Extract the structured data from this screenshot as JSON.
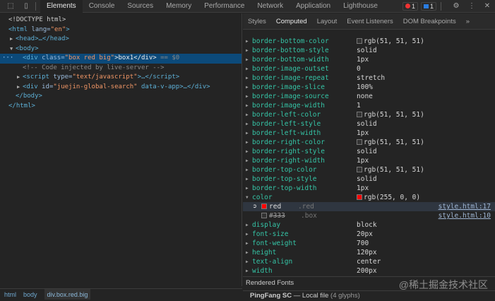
{
  "toolbar": {
    "tabs": [
      "Elements",
      "Console",
      "Sources",
      "Memory",
      "Performance",
      "Network",
      "Application",
      "Lighthouse"
    ],
    "errors": "1",
    "messages": "1"
  },
  "dom": {
    "doctype": "<!DOCTYPE html>",
    "html_open": "<html",
    "lang_attr": " lang=",
    "lang_val": "\"en\"",
    "head": "<head>…</head>",
    "body_open": "<body>",
    "div_open": "<div",
    "div_attr": " class=",
    "div_val": "\"box red big\"",
    "div_text": ">box1</div>",
    "div_marker": " == $0",
    "comment": "<!-- Code injected by live-server -->",
    "script_open": "<script",
    "script_attr": " type=",
    "script_val": "\"text/javascript\"",
    "script_close": ">…</script>",
    "div2_open": "<div",
    "div2_attr": " id=",
    "div2_val": "\"juejin-global-search\"",
    "div2_rest": " data-v-app>…</div>",
    "body_close": "</body>",
    "html_close": "</html>"
  },
  "breadcrumbs": [
    "html",
    "body",
    "div.box.red.big"
  ],
  "subtabs": [
    "Styles",
    "Computed",
    "Layout",
    "Event Listeners",
    "DOM Breakpoints",
    "»"
  ],
  "props": [
    {
      "name": "border-bottom-color",
      "value": "rgb(51, 51, 51)",
      "swatch": "#333333"
    },
    {
      "name": "border-bottom-style",
      "value": "solid"
    },
    {
      "name": "border-bottom-width",
      "value": "1px"
    },
    {
      "name": "border-image-outset",
      "value": "0"
    },
    {
      "name": "border-image-repeat",
      "value": "stretch"
    },
    {
      "name": "border-image-slice",
      "value": "100%"
    },
    {
      "name": "border-image-source",
      "value": "none"
    },
    {
      "name": "border-image-width",
      "value": "1"
    },
    {
      "name": "border-left-color",
      "value": "rgb(51, 51, 51)",
      "swatch": "#333333"
    },
    {
      "name": "border-left-style",
      "value": "solid"
    },
    {
      "name": "border-left-width",
      "value": "1px"
    },
    {
      "name": "border-right-color",
      "value": "rgb(51, 51, 51)",
      "swatch": "#333333"
    },
    {
      "name": "border-right-style",
      "value": "solid"
    },
    {
      "name": "border-right-width",
      "value": "1px"
    },
    {
      "name": "border-top-color",
      "value": "rgb(51, 51, 51)",
      "swatch": "#333333"
    },
    {
      "name": "border-top-style",
      "value": "solid"
    },
    {
      "name": "border-top-width",
      "value": "1px"
    },
    {
      "name": "color",
      "value": "rgb(255, 0, 0)",
      "swatch": "#ff0000"
    }
  ],
  "color_traces": [
    {
      "value": "red",
      "selector": ".red",
      "source": "style.html:17",
      "swatch": "#ff0000"
    },
    {
      "value": "#333",
      "selector": ".box",
      "source": "style.html:10",
      "swatch": "#333333"
    }
  ],
  "props2": [
    {
      "name": "display",
      "value": "block"
    },
    {
      "name": "font-size",
      "value": "20px"
    },
    {
      "name": "font-weight",
      "value": "700"
    },
    {
      "name": "height",
      "value": "120px"
    },
    {
      "name": "text-align",
      "value": "center"
    },
    {
      "name": "width",
      "value": "200px"
    }
  ],
  "rendered_fonts": {
    "title": "Rendered Fonts",
    "font": "PingFang SC",
    "dash": "—",
    "source": "Local file",
    "glyphs": "(4 glyphs)"
  },
  "watermark": "@稀土掘金技术社区"
}
